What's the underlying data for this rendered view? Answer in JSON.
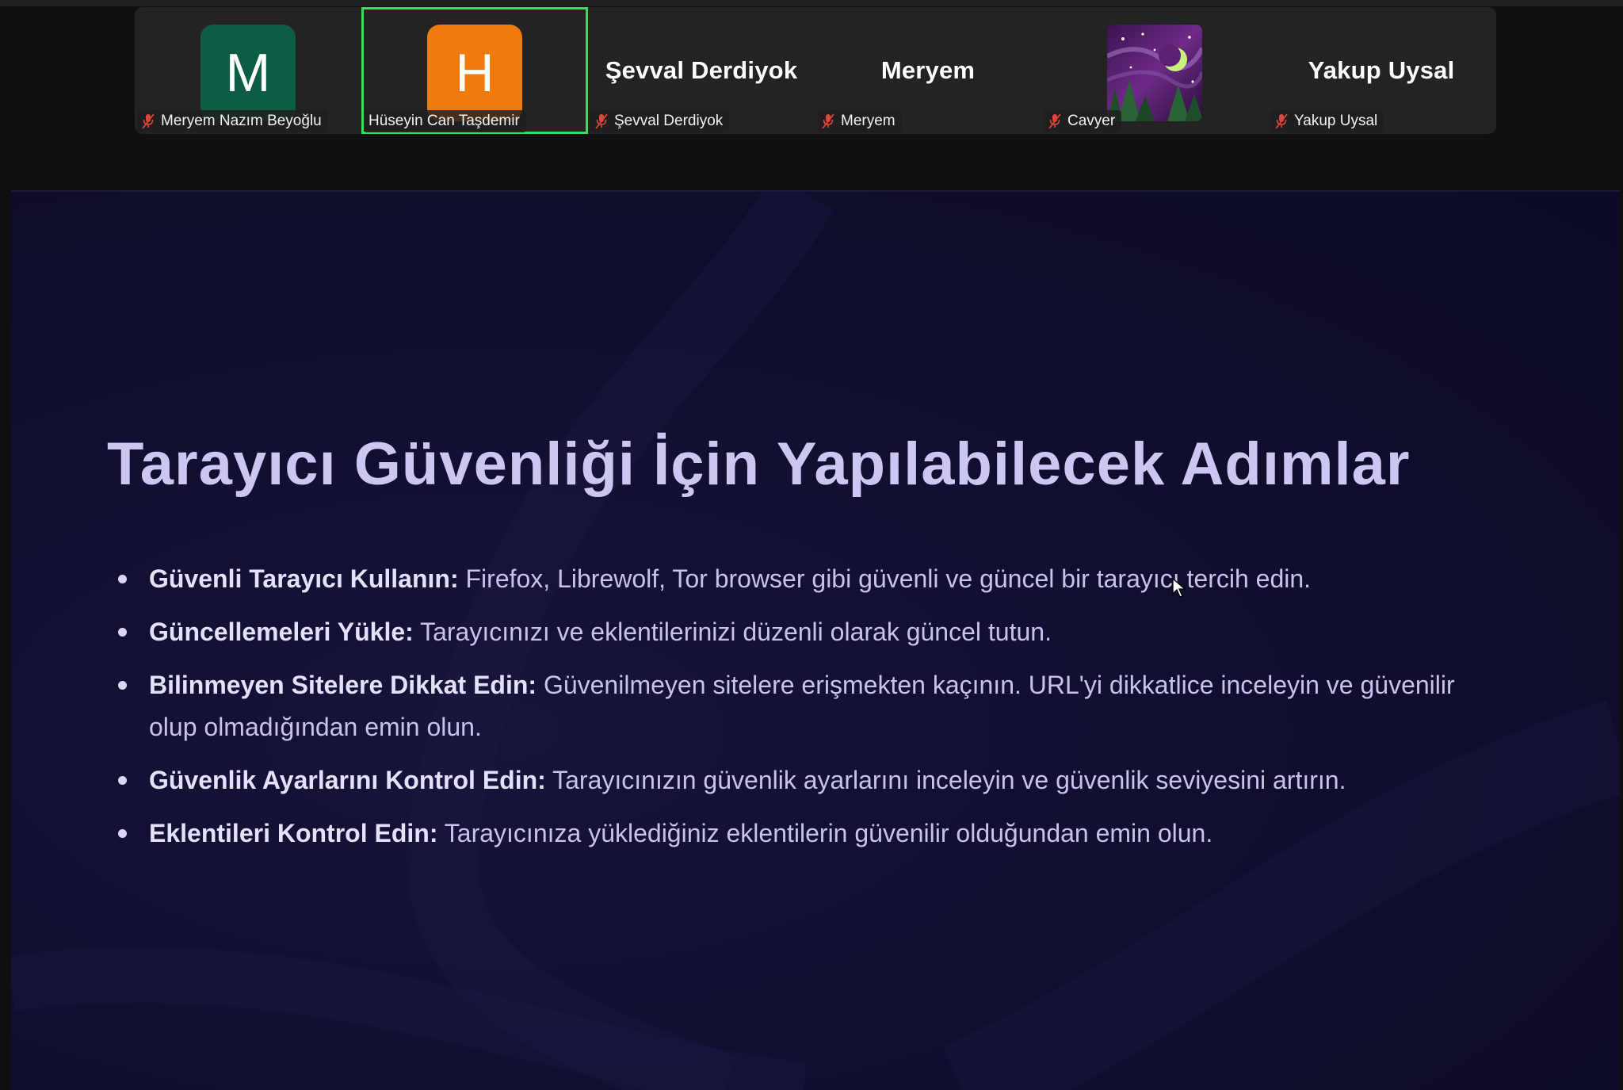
{
  "participants": [
    {
      "display_name": "Meryem Nazım Beyoğlu",
      "avatar_letter": "M",
      "avatar_color": "#0d5c46",
      "mic_muted": true
    },
    {
      "display_name": "Hüseyin Can Taşdemir",
      "avatar_letter": "H",
      "avatar_color": "#f07b0c",
      "mic_muted": true,
      "active_speaker": true
    },
    {
      "display_name": "Şevval Derdiyok",
      "big_name": "Şevval Derdiyok",
      "mic_muted": true
    },
    {
      "display_name": "Meryem",
      "big_name": "Meryem",
      "mic_muted": true
    },
    {
      "display_name": "Cavyer",
      "avatar": "moon-night-photo",
      "mic_muted": true
    },
    {
      "display_name": "Yakup Uysal",
      "big_name": "Yakup Uysal",
      "mic_muted": true
    }
  ],
  "slide": {
    "title": "Tarayıcı Güvenliği İçin Yapılabilecek Adımlar",
    "bullets": [
      {
        "bold": "Güvenli Tarayıcı Kullanın:",
        "text": " Firefox, Librewolf, Tor browser gibi güvenli ve güncel bir tarayıcı tercih edin."
      },
      {
        "bold": "Güncellemeleri Yükle:",
        "text": " Tarayıcınızı ve eklentilerinizi düzenli olarak güncel tutun."
      },
      {
        "bold": "Bilinmeyen Sitelere Dikkat Edin:",
        "text": " Güvenilmeyen sitelere erişmekten kaçının. URL'yi dikkatlice inceleyin ve güvenilir olup olmadığından emin olun."
      },
      {
        "bold": "Güvenlik Ayarlarını Kontrol Edin:",
        "text": " Tarayıcınızın güvenlik ayarlarını inceleyin ve güvenlik seviyesini artırın."
      },
      {
        "bold": "Eklentileri Kontrol Edin:",
        "text": " Tarayıcınıza yüklediğiniz eklentilerin güvenilir olduğundan emin olun."
      }
    ]
  },
  "colors": {
    "active_speaker_border": "#2ee35f",
    "muted_mic": "#e0453a",
    "slide_background": "#0f0e2d",
    "slide_text": "#c7c3ec"
  }
}
